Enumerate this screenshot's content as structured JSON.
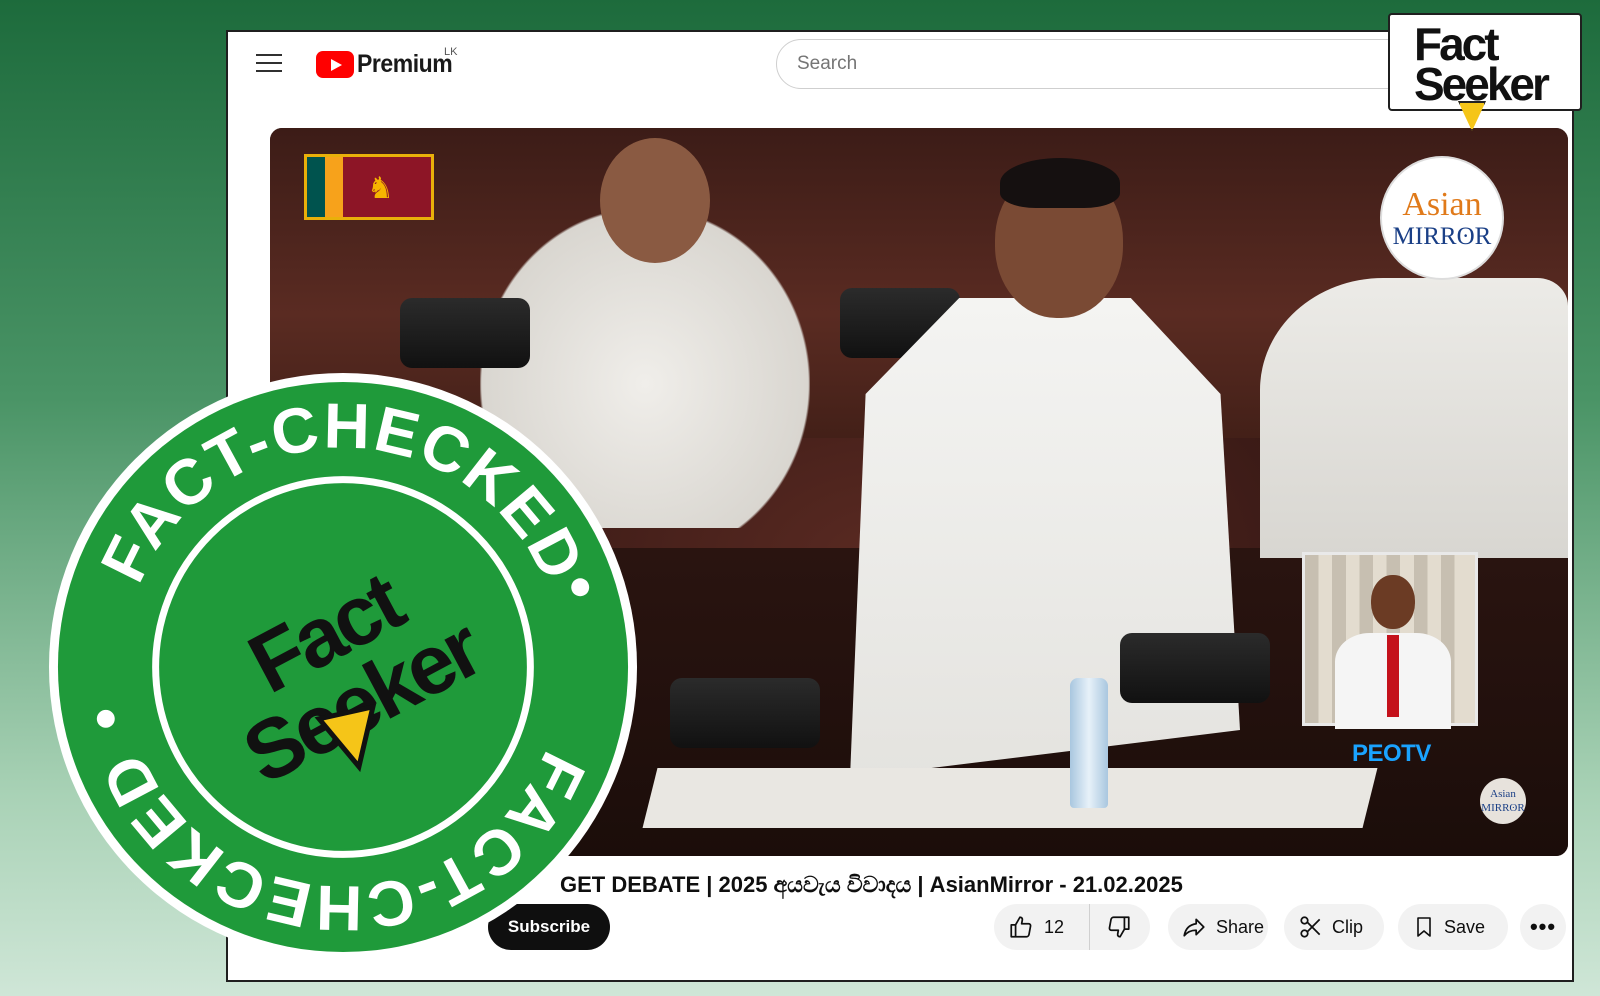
{
  "header": {
    "brand": "Premium",
    "region": "LK",
    "search_placeholder": "Search"
  },
  "watermark": {
    "line1": "Fact",
    "line2": "Seeker"
  },
  "video": {
    "channel_logo_line1": "Asian",
    "channel_logo_line2": "MIRRʘR",
    "channel_logo_small_line1": "Asian",
    "channel_logo_small_line2": "MIRRʘR",
    "broadcaster": "PEOTV",
    "title": "GET DEBATE | 2025 අයවැය විවාදය | AsianMirror - 21.02.2025"
  },
  "actions": {
    "subscribe": "Subscribe",
    "like_count": "12",
    "share": "Share",
    "clip": "Clip",
    "save": "Save",
    "more": "•••"
  },
  "stamp": {
    "ring_top": "FACT-CHECKED",
    "ring_bottom": "FACT-CHECKED",
    "center_line1": "Fact",
    "center_line2": "Seeker",
    "color": "#1f9a3a"
  }
}
